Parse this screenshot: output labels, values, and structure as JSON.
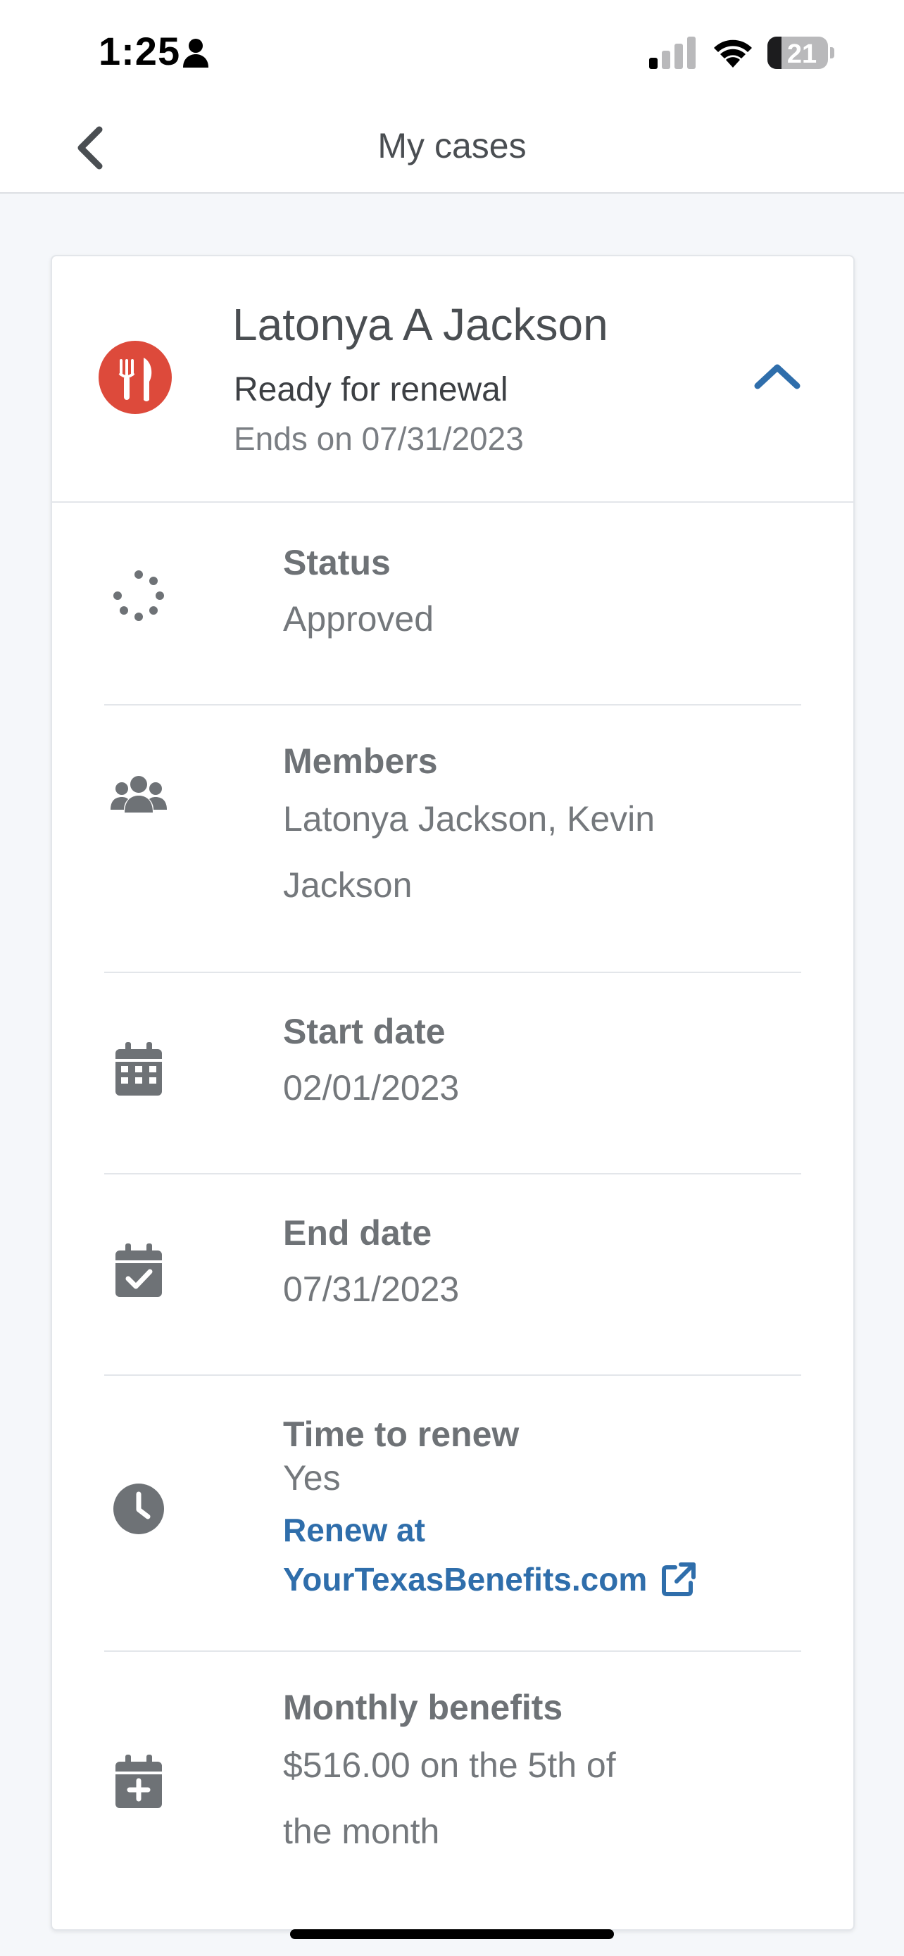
{
  "status_bar": {
    "time": "1:25",
    "battery": "21"
  },
  "nav": {
    "title": "My cases"
  },
  "case": {
    "name": "Latonya A Jackson",
    "status": "Ready for renewal",
    "ends": "Ends on 07/31/2023",
    "icon_color": "#dd4a3b",
    "icon": "fork-knife-icon"
  },
  "details": {
    "status": {
      "label": "Status",
      "value": "Approved"
    },
    "members": {
      "label": "Members",
      "value_line1": "Latonya Jackson, Kevin",
      "value_line2": "Jackson"
    },
    "start_date": {
      "label": "Start date",
      "value": "02/01/2023"
    },
    "end_date": {
      "label": "End date",
      "value": "07/31/2023"
    },
    "time_to_renew": {
      "label": "Time to renew",
      "value": "Yes",
      "link_line1": "Renew at",
      "link_line2": "YourTexasBenefits.com"
    },
    "monthly_benefits": {
      "label": "Monthly benefits",
      "value_line1": "$516.00 on the 5th of",
      "value_line2": "the month"
    }
  },
  "colors": {
    "accent": "#2f6eab",
    "background": "#f5f7fa",
    "text_muted": "#74787c"
  }
}
